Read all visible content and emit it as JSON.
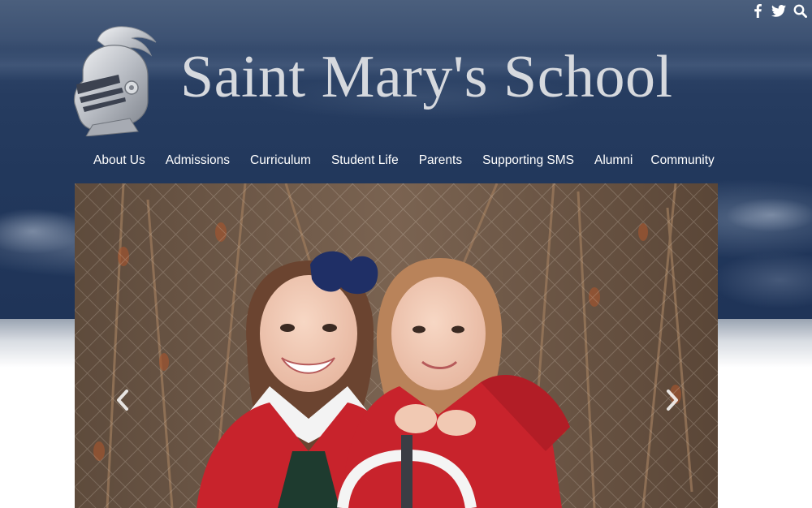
{
  "site": {
    "title": "Saint Mary's School",
    "logo_icon": "knight-helmet-icon"
  },
  "social": [
    {
      "name": "facebook",
      "icon": "facebook-icon"
    },
    {
      "name": "twitter",
      "icon": "twitter-icon"
    },
    {
      "name": "search",
      "icon": "search-icon"
    }
  ],
  "nav": {
    "items": [
      {
        "label": "About Us"
      },
      {
        "label": "Admissions"
      },
      {
        "label": "Curriculum"
      },
      {
        "label": "Student Life"
      },
      {
        "label": "Parents"
      },
      {
        "label": "Supporting SMS"
      },
      {
        "label": "Alumni"
      },
      {
        "label": "Community"
      }
    ]
  },
  "hero": {
    "prev_icon": "chevron-left-icon",
    "next_icon": "chevron-right-icon"
  },
  "colors": {
    "banner_navy": "#22385c",
    "title_silver": "#d6d9de",
    "nav_text": "#ffffff",
    "coat_red": "#c8232c",
    "bow_navy": "#1f2f66"
  }
}
